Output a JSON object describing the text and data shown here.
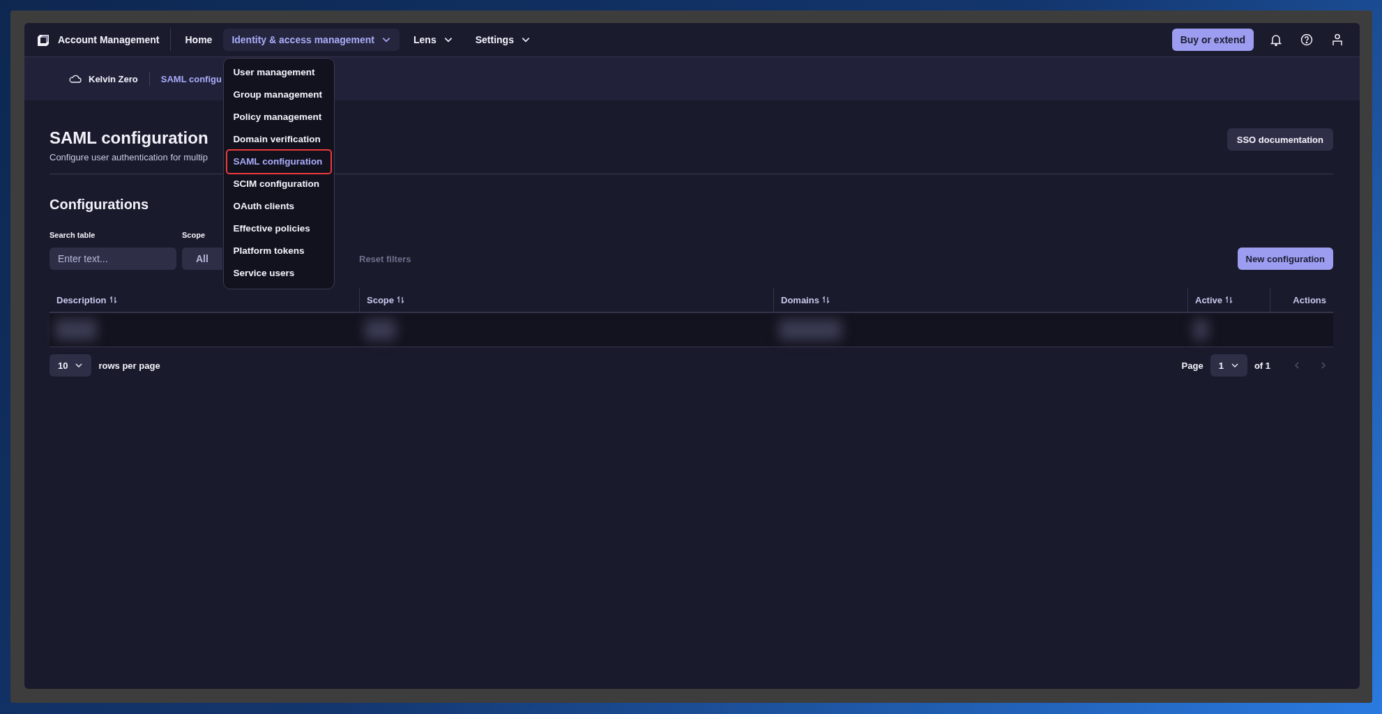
{
  "app": {
    "name": "Account Management"
  },
  "nav": [
    {
      "label": "Home",
      "selected": false,
      "has_menu": false
    },
    {
      "label": "Identity & access management",
      "selected": true,
      "has_menu": true,
      "menu": [
        {
          "label": "User management",
          "selected": false
        },
        {
          "label": "Group management",
          "selected": false
        },
        {
          "label": "Policy management",
          "selected": false
        },
        {
          "label": "Domain verification",
          "selected": false
        },
        {
          "label": "SAML configuration",
          "selected": true
        },
        {
          "label": "SCIM configuration",
          "selected": false
        },
        {
          "label": "OAuth clients",
          "selected": false
        },
        {
          "label": "Effective policies",
          "selected": false
        },
        {
          "label": "Platform tokens",
          "selected": false
        },
        {
          "label": "Service users",
          "selected": false
        }
      ]
    },
    {
      "label": "Lens",
      "selected": false,
      "has_menu": true
    },
    {
      "label": "Settings",
      "selected": false,
      "has_menu": true
    }
  ],
  "header_actions": {
    "primary_button": "Buy or extend"
  },
  "breadcrumbs": [
    "Kelvin Zero",
    "SAML configu"
  ],
  "page": {
    "title": "SAML configuration",
    "subtitle": "Configure user authentication for multip",
    "doc_button": "SSO documentation"
  },
  "section_title": "Configurations",
  "filters": {
    "search": {
      "label": "Search table",
      "placeholder": "Enter text..."
    },
    "scope": {
      "label": "Scope",
      "value": "All"
    },
    "reset": "Reset filters",
    "new_button": "New configuration"
  },
  "table": {
    "columns": [
      {
        "label": "Description",
        "sortable": true
      },
      {
        "label": "Scope",
        "sortable": true
      },
      {
        "label": "Domains",
        "sortable": true
      },
      {
        "label": "Active",
        "sortable": true
      },
      {
        "label": "Actions",
        "sortable": false
      }
    ],
    "rows": [
      {
        "kind": "redacted"
      }
    ]
  },
  "pagination": {
    "rows_per_page": "10",
    "rows_label": "rows per page",
    "page_label": "Page",
    "page": "1",
    "of": "of 1",
    "prev_disabled": true,
    "next_disabled": true
  }
}
